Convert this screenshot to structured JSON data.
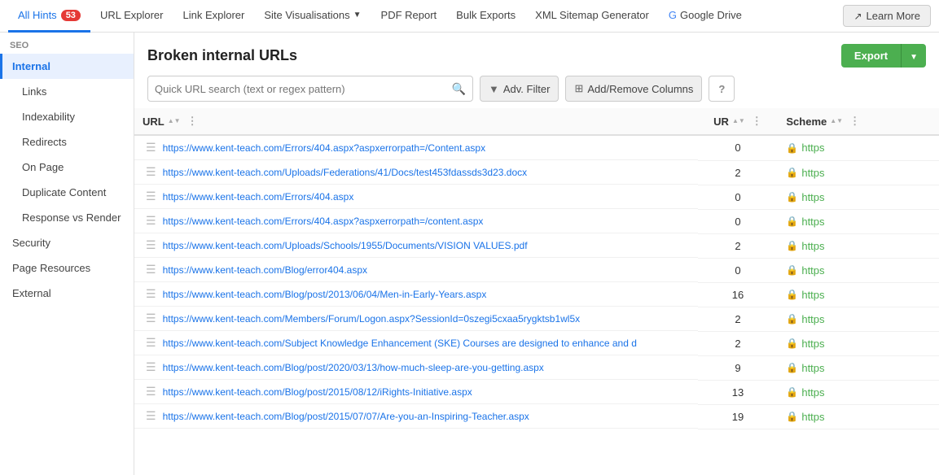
{
  "topNav": {
    "items": [
      {
        "id": "all-hints",
        "label": "All Hints",
        "badge": "53",
        "active": true
      },
      {
        "id": "url-explorer",
        "label": "URL Explorer",
        "badge": null,
        "active": false
      },
      {
        "id": "link-explorer",
        "label": "Link Explorer",
        "badge": null,
        "active": false
      },
      {
        "id": "site-visualisations",
        "label": "Site Visualisations",
        "badge": null,
        "active": false,
        "dropdown": true
      },
      {
        "id": "pdf-report",
        "label": "PDF Report",
        "badge": null,
        "active": false
      },
      {
        "id": "bulk-exports",
        "label": "Bulk Exports",
        "badge": null,
        "active": false
      },
      {
        "id": "xml-sitemap-generator",
        "label": "XML Sitemap Generator",
        "badge": null,
        "active": false
      },
      {
        "id": "google-drive",
        "label": "Google Drive",
        "badge": null,
        "active": false,
        "google": true
      }
    ],
    "learnMore": "Learn More"
  },
  "sidebar": {
    "sections": [
      {
        "label": "SEO",
        "items": [
          {
            "id": "internal",
            "label": "Internal",
            "active": true,
            "indent": 0
          },
          {
            "id": "links",
            "label": "Links",
            "active": false,
            "indent": 1
          },
          {
            "id": "indexability",
            "label": "Indexability",
            "active": false,
            "indent": 1
          },
          {
            "id": "redirects",
            "label": "Redirects",
            "active": false,
            "indent": 1
          },
          {
            "id": "on-page",
            "label": "On Page",
            "active": false,
            "indent": 1
          },
          {
            "id": "duplicate-content",
            "label": "Duplicate Content",
            "active": false,
            "indent": 1
          },
          {
            "id": "response-vs-render",
            "label": "Response vs Render",
            "active": false,
            "indent": 1
          },
          {
            "id": "security",
            "label": "Security",
            "active": false,
            "indent": 0
          },
          {
            "id": "page-resources",
            "label": "Page Resources",
            "active": false,
            "indent": 0
          },
          {
            "id": "external",
            "label": "External",
            "active": false,
            "indent": 0
          }
        ]
      }
    ]
  },
  "content": {
    "title": "Broken internal URLs",
    "toolbar": {
      "searchPlaceholder": "Quick URL search (text or regex pattern)",
      "advFilterLabel": "Adv. Filter",
      "addRemoveColumnsLabel": "Add/Remove Columns",
      "exportLabel": "Export"
    },
    "table": {
      "columns": [
        {
          "id": "url",
          "label": "URL"
        },
        {
          "id": "ur",
          "label": "UR"
        },
        {
          "id": "scheme",
          "label": "Scheme"
        }
      ],
      "rows": [
        {
          "url": "https://www.kent-teach.com/Errors/404.aspx?aspxerrorpath=/Content.aspx",
          "ur": "0",
          "scheme": "https"
        },
        {
          "url": "https://www.kent-teach.com/Uploads/Federations/41/Docs/test453fdassds3d23.docx",
          "ur": "2",
          "scheme": "https"
        },
        {
          "url": "https://www.kent-teach.com/Errors/404.aspx",
          "ur": "0",
          "scheme": "https"
        },
        {
          "url": "https://www.kent-teach.com/Errors/404.aspx?aspxerrorpath=/content.aspx",
          "ur": "0",
          "scheme": "https"
        },
        {
          "url": "https://www.kent-teach.com/Uploads/Schools/1955/Documents/VISION VALUES.pdf",
          "ur": "2",
          "scheme": "https"
        },
        {
          "url": "https://www.kent-teach.com/Blog/error404.aspx",
          "ur": "0",
          "scheme": "https"
        },
        {
          "url": "https://www.kent-teach.com/Blog/post/2013/06/04/Men-in-Early-Years.aspx",
          "ur": "16",
          "scheme": "https"
        },
        {
          "url": "https://www.kent-teach.com/Members/Forum/Logon.aspx?SessionId=0szegi5cxaa5rygktsb1wl5x",
          "ur": "2",
          "scheme": "https"
        },
        {
          "url": "https://www.kent-teach.com/Subject Knowledge Enhancement (SKE) Courses are designed to enhance and d",
          "ur": "2",
          "scheme": "https"
        },
        {
          "url": "https://www.kent-teach.com/Blog/post/2020/03/13/how-much-sleep-are-you-getting.aspx",
          "ur": "9",
          "scheme": "https"
        },
        {
          "url": "https://www.kent-teach.com/Blog/post/2015/08/12/iRights-Initiative.aspx",
          "ur": "13",
          "scheme": "https"
        },
        {
          "url": "https://www.kent-teach.com/Blog/post/2015/07/07/Are-you-an-Inspiring-Teacher.aspx",
          "ur": "19",
          "scheme": "https"
        }
      ]
    }
  }
}
